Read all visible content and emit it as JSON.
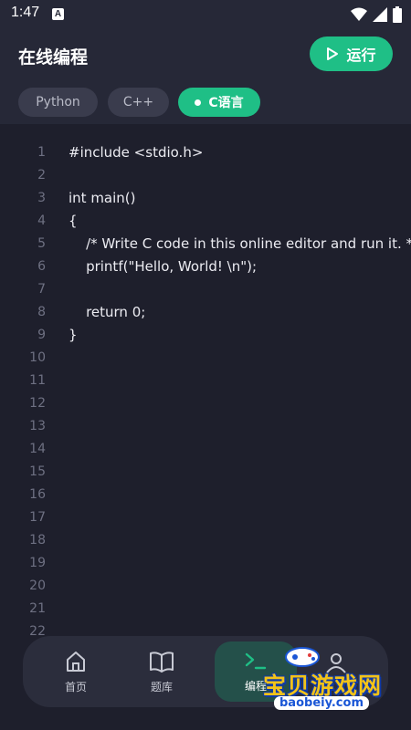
{
  "status": {
    "time": "1:47",
    "a_icon": "A"
  },
  "header": {
    "title": "在线编程",
    "run_label": "运行",
    "tabs": [
      {
        "label": "Python",
        "active": false
      },
      {
        "label": "C++",
        "active": false
      },
      {
        "label": "C语言",
        "active": true
      }
    ]
  },
  "editor": {
    "line_numbers": [
      "1",
      "2",
      "3",
      "4",
      "5",
      "6",
      "7",
      "8",
      "9",
      "10",
      "11",
      "12",
      "13",
      "14",
      "15",
      "16",
      "17",
      "18",
      "19",
      "20",
      "21",
      "22"
    ],
    "lines": [
      "#include <stdio.h>",
      "",
      "int main()",
      "{",
      "    /* Write C code in this online editor and run it. */",
      "    printf(\"Hello, World! \\n\");",
      "",
      "    return 0;",
      "}"
    ]
  },
  "bottom_nav": {
    "items": [
      {
        "label": "首页",
        "icon": "home-icon"
      },
      {
        "label": "题库",
        "icon": "book-icon"
      },
      {
        "label": "编程",
        "icon": "terminal-icon",
        "active": true
      }
    ]
  },
  "watermark": {
    "text": "宝贝游戏网",
    "url": "baobeiy.com"
  },
  "colors": {
    "accent": "#1fbf86",
    "background": "#1e1f2c",
    "header": "#262837"
  }
}
